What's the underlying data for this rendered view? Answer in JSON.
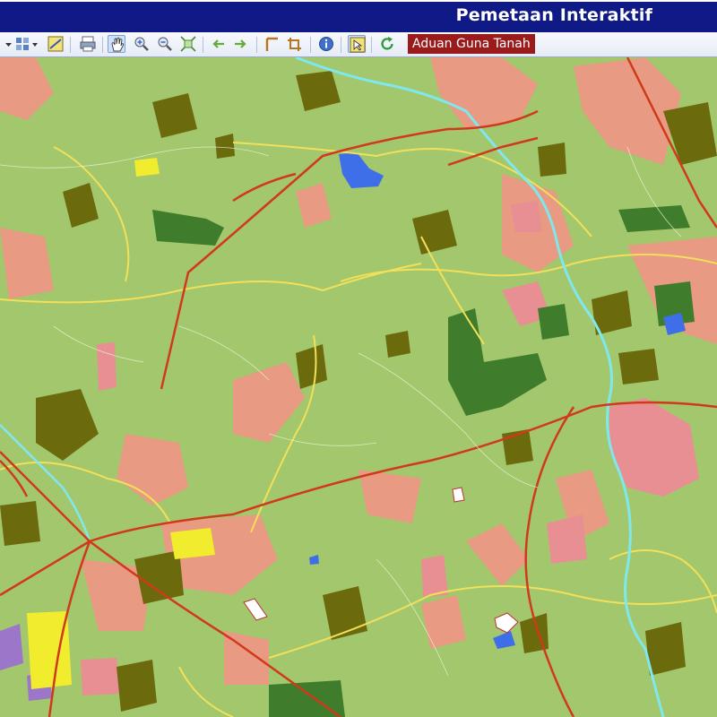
{
  "header": {
    "title": "Pemetaan Interaktif"
  },
  "toolbar": {
    "tools": [
      {
        "icon": "chevron-down-icon"
      },
      {
        "icon": "layers-icon"
      },
      {
        "icon": "map-legend-icon"
      },
      {
        "icon": "print-icon"
      },
      {
        "icon": "pan-hand-icon",
        "active": true
      },
      {
        "icon": "zoom-in-icon"
      },
      {
        "icon": "zoom-out-icon"
      },
      {
        "icon": "full-extent-icon"
      },
      {
        "icon": "back-arrow-icon"
      },
      {
        "icon": "forward-arrow-icon"
      },
      {
        "icon": "measure-line-icon"
      },
      {
        "icon": "measure-area-icon"
      },
      {
        "icon": "info-icon"
      },
      {
        "icon": "select-icon",
        "active": true
      },
      {
        "icon": "refresh-icon"
      }
    ],
    "complaint_label": "Aduan Guna Tanah"
  },
  "map": {
    "colors": {
      "background": "#a3c76c",
      "agriculture_dark": "#6b6a0c",
      "forest": "#3f7d2c",
      "urban": "#e89a82",
      "institution": "#e88f93",
      "water_body": "#3f6fe8",
      "river": "#7fe8ee",
      "main_road": "#d0391b",
      "minor_road": "#f2e05a",
      "residential": "#f2ec2e",
      "industrial": "#9b76c9"
    }
  }
}
